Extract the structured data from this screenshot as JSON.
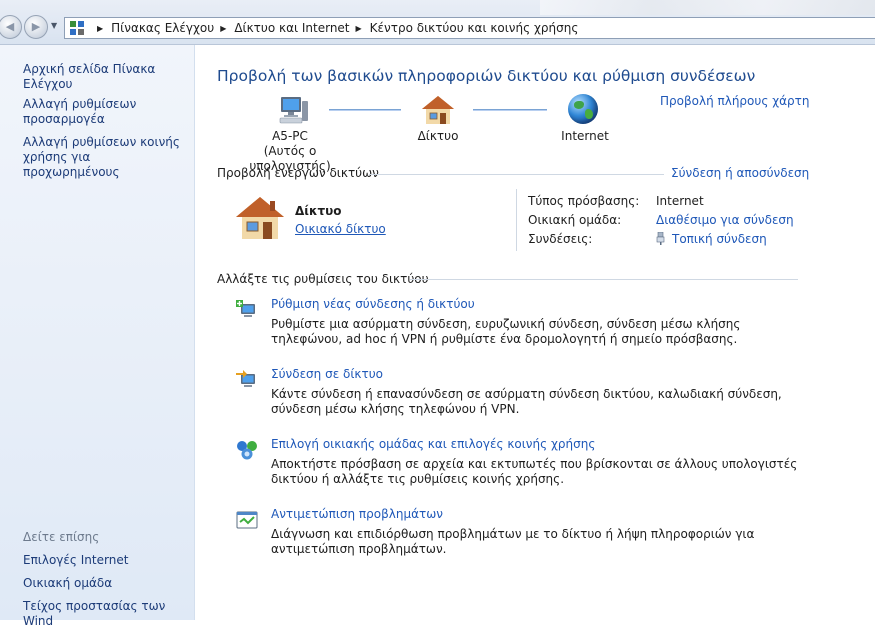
{
  "address_bar": {
    "breadcrumbs": [
      "Πίνακας Ελέγχου",
      "Δίκτυο και Internet",
      "Κέντρο δικτύου και κοινής χρήσης"
    ]
  },
  "left_pane": {
    "home": "Αρχική σελίδα Πίνακα Ελέγχου",
    "change_adapter": "Αλλαγή ρυθμίσεων προσαρμογέα",
    "change_sharing": "Αλλαγή ρυθμίσεων κοινής χρήσης για προχωρημένους",
    "see_also": "Δείτε επίσης",
    "internet_options": "Επιλογές Internet",
    "homegroup": "Οικιακή ομάδα",
    "firewall": "Τείχος προστασίας των Wind"
  },
  "main": {
    "title": "Προβολή των βασικών πληροφοριών δικτύου και ρύθμιση συνδέσεων",
    "full_map": "Προβολή πλήρους χάρτη",
    "map": {
      "computer_name": "A5-PC",
      "computer_sub": "(Αυτός ο υπολογιστής)",
      "network": "Δίκτυο",
      "internet": "Internet"
    },
    "active_networks_header": "Προβολή ενεργών δικτύων",
    "connect_disconnect": "Σύνδεση ή αποσύνδεση",
    "active_network": {
      "name": "Δίκτυο",
      "type": "Οικιακό δίκτυο",
      "access_type_label": "Τύπος πρόσβασης:",
      "access_type_value": "Internet",
      "homegroup_label": "Οικιακή ομάδα:",
      "homegroup_value": "Διαθέσιμο για σύνδεση",
      "connections_label": "Συνδέσεις:",
      "connections_value": "Τοπική σύνδεση"
    },
    "change_settings_header": "Αλλάξτε τις ρυθμίσεις του δικτύου",
    "tasks": [
      {
        "title": "Ρύθμιση νέας σύνδεσης ή δικτύου",
        "desc": "Ρυθμίστε μια ασύρματη σύνδεση, ευρυζωνική σύνδεση,  σύνδεση μέσω κλήσης τηλεφώνου, ad hoc ή VPN ή ρυθμίστε ένα δρομολογητή ή σημείο πρόσβασης."
      },
      {
        "title": "Σύνδεση σε δίκτυο",
        "desc": "Κάντε σύνδεση ή επανασύνδεση σε ασύρματη σύνδεση δικτύου, καλωδιακή σύνδεση, σύνδεση μέσω κλήσης τηλεφώνου ή VPN."
      },
      {
        "title": "Επιλογή οικιακής ομάδας και επιλογές κοινής χρήσης",
        "desc": "Αποκτήστε πρόσβαση σε αρχεία και εκτυπωτές που βρίσκονται σε άλλους υπολογιστές δικτύου ή αλλάξτε τις ρυθμίσεις κοινής χρήσης."
      },
      {
        "title": "Αντιμετώπιση προβλημάτων",
        "desc": "Διάγνωση και επιδιόρθωση προβλημάτων με το δίκτυο ή λήψη πληροφοριών για αντιμετώπιση προβλημάτων."
      }
    ]
  },
  "colors": {
    "link": "#1f58b8",
    "title": "#1f4b8f",
    "left_pane_bg": "#e9f0f9"
  }
}
